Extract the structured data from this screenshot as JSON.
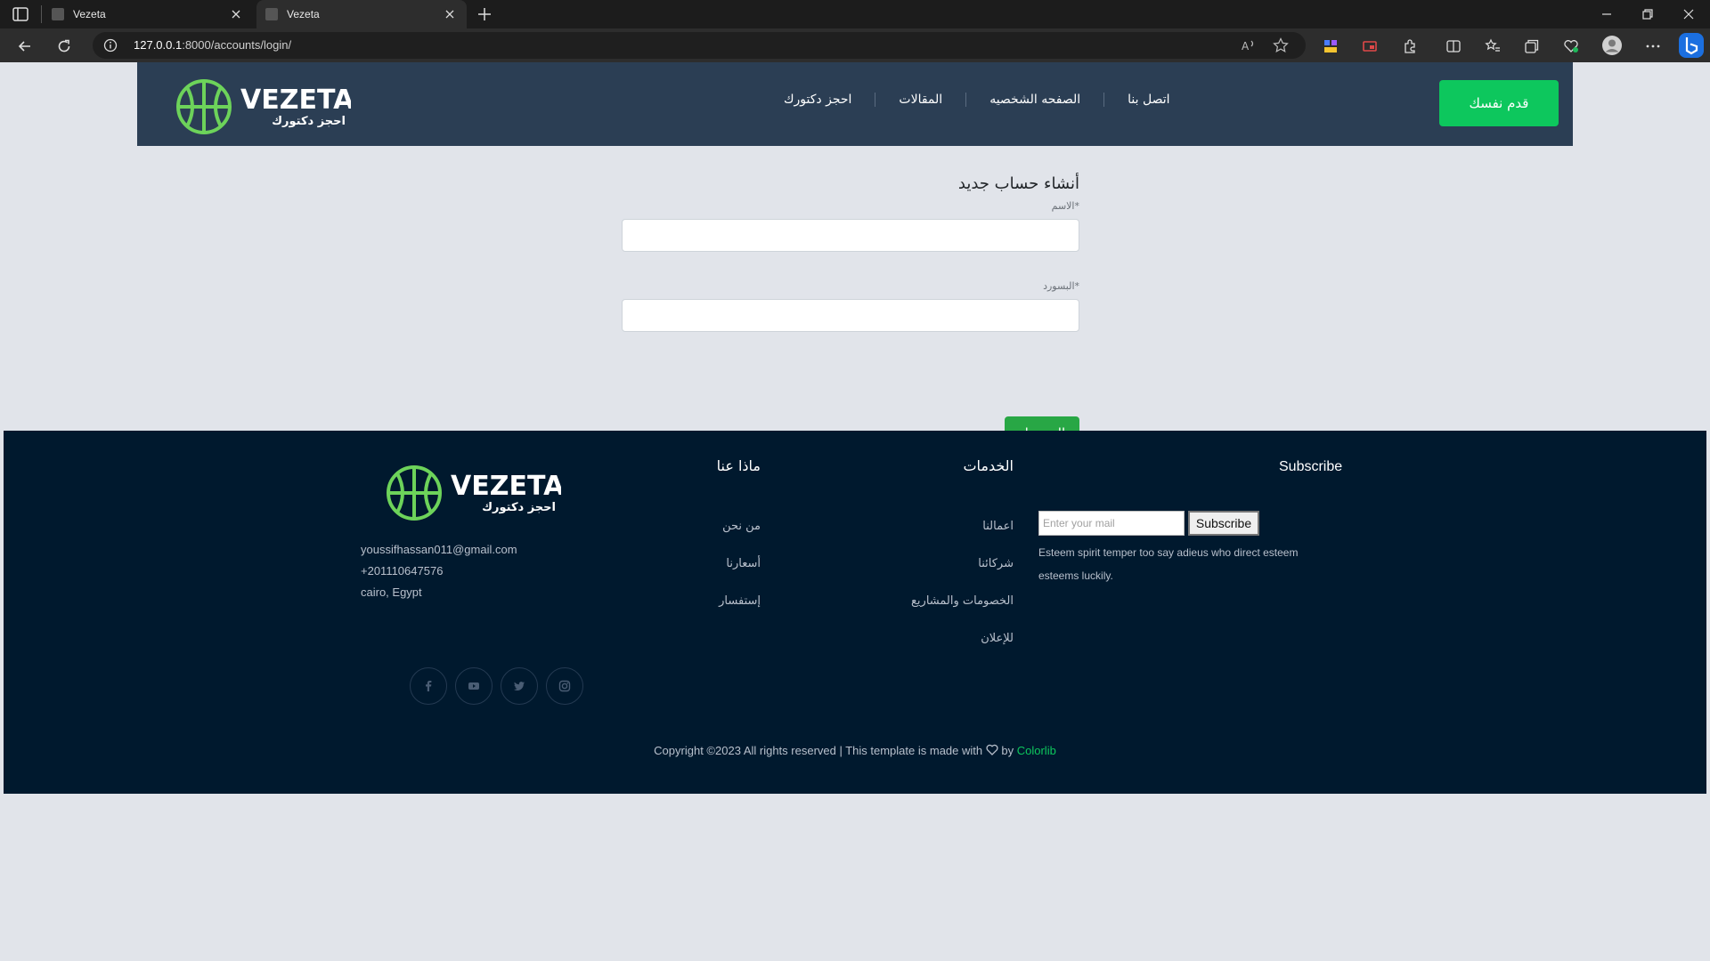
{
  "browser": {
    "tabs": [
      {
        "title": "Vezeta"
      },
      {
        "title": "Vezeta"
      }
    ],
    "address": {
      "host": "127.0.0.1",
      "path": ":8000/accounts/login/"
    }
  },
  "header": {
    "logo": {
      "wordmark": "VEZETA",
      "tagline": "احجز دكتورك"
    },
    "nav": [
      "اتصل بنا",
      "الصفحه الشخصيه",
      "المقالات",
      "احجز دكتورك"
    ],
    "cta_label": "قدم نفسك",
    "colors": {
      "bar": "#2b3e54",
      "accent": "#0dc75d"
    }
  },
  "form": {
    "title": "أنشاء حساب جديد",
    "fields": [
      {
        "label": "الاسم",
        "required_mark": "*"
      },
      {
        "label": "البسورد",
        "required_mark": "*"
      }
    ],
    "submit_label": "التسجيل"
  },
  "footer": {
    "logo": {
      "wordmark": "VEZETA",
      "tagline": "احجز دكتورك"
    },
    "contact": {
      "email": "youssifhassan011@gmail.com",
      "phone": "+201110647576",
      "address": "cairo, Egypt"
    },
    "social_icons": [
      "facebook-icon",
      "youtube-icon",
      "twitter-icon",
      "instagram-icon"
    ],
    "about": {
      "heading": "ماذا عنا",
      "links": [
        "من نحن",
        "أسعارنا",
        "إستفسار"
      ]
    },
    "services": {
      "heading": "الخدمات",
      "links": [
        "اعمالنا",
        "شركائنا",
        "الخصومات والمشاريع",
        "للإعلان"
      ]
    },
    "subscribe": {
      "heading": "Subscribe",
      "placeholder": "Enter your mail",
      "button_label": "Subscribe",
      "text": "Esteem spirit temper too say adieus who direct esteem esteems luckily."
    },
    "copyright": {
      "prefix": "Copyright ©2023 All rights reserved | This template is made with",
      "by": "by",
      "brand": "Colorlib"
    },
    "colors": {
      "background": "#00192e"
    }
  }
}
